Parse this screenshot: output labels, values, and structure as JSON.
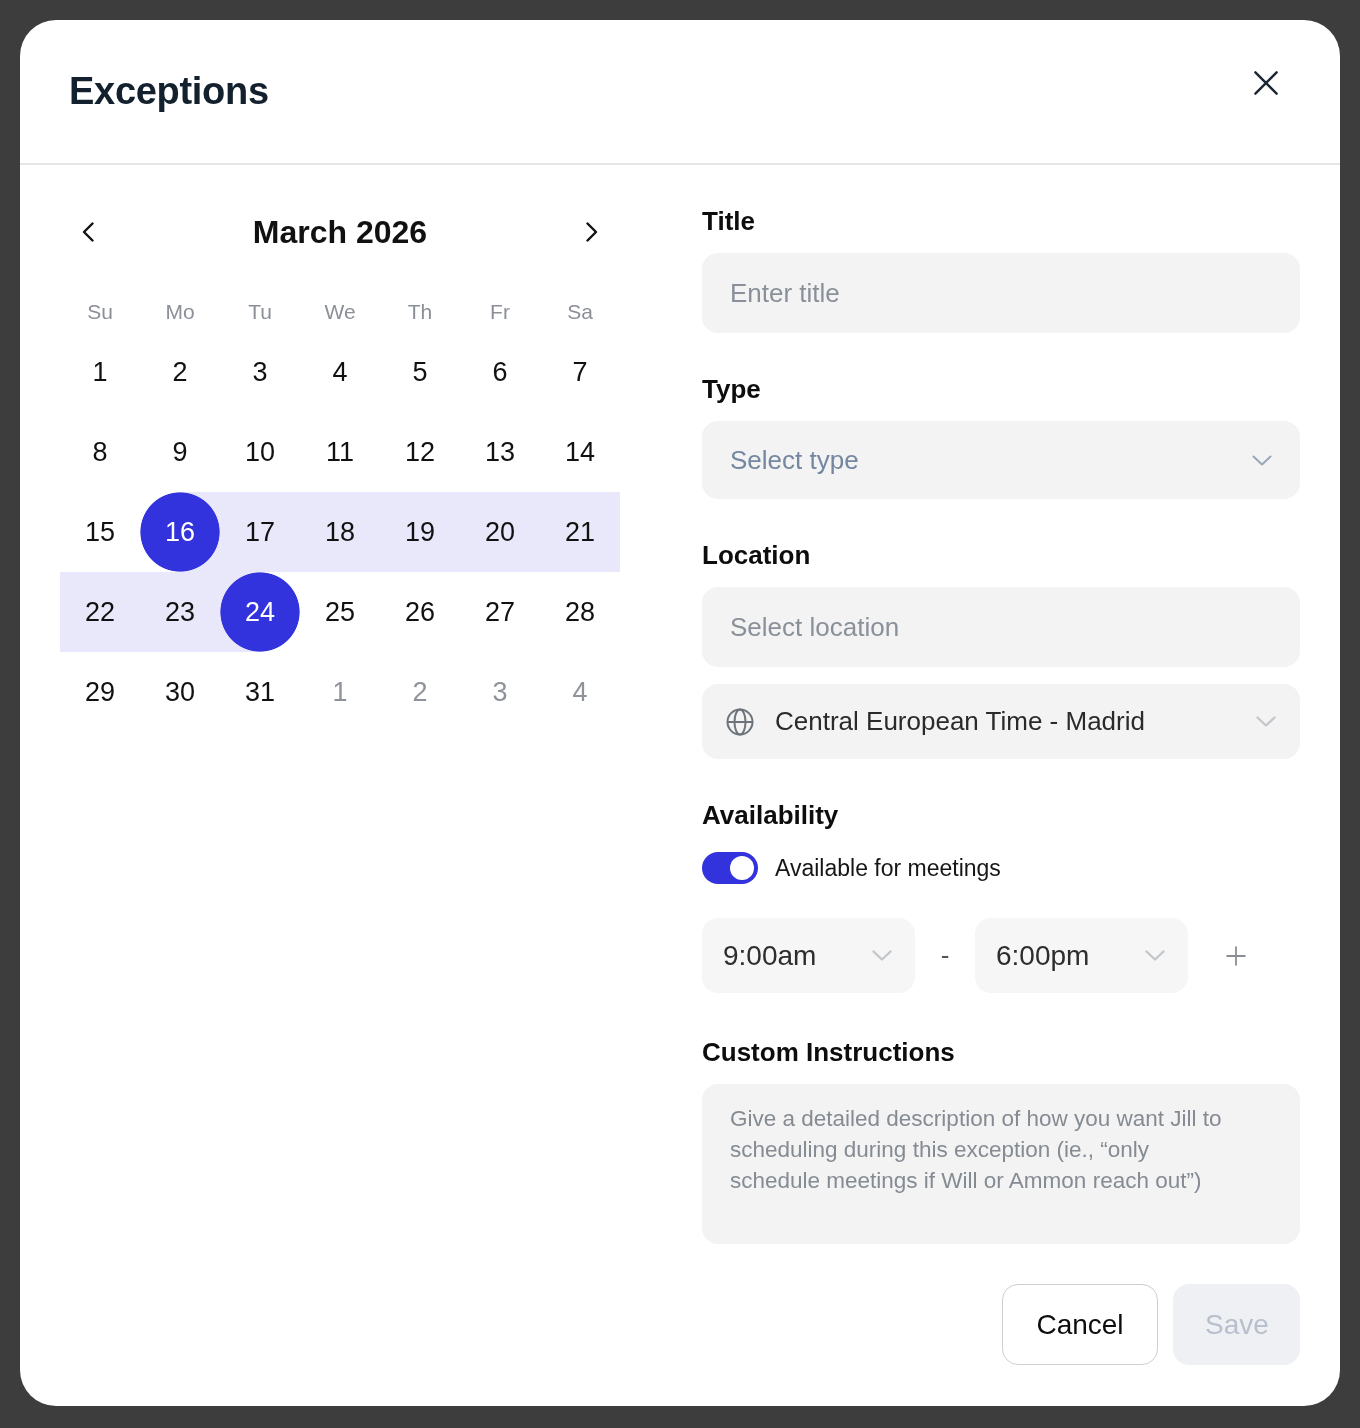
{
  "dialog": {
    "title": "Exceptions"
  },
  "calendar": {
    "month_title": "March 2026",
    "weekdays": [
      "Su",
      "Mo",
      "Tu",
      "We",
      "Th",
      "Fr",
      "Sa"
    ],
    "days": [
      {
        "label": "1",
        "selected": false,
        "in_range": false,
        "outside": false
      },
      {
        "label": "2",
        "selected": false,
        "in_range": false,
        "outside": false
      },
      {
        "label": "3",
        "selected": false,
        "in_range": false,
        "outside": false
      },
      {
        "label": "4",
        "selected": false,
        "in_range": false,
        "outside": false
      },
      {
        "label": "5",
        "selected": false,
        "in_range": false,
        "outside": false
      },
      {
        "label": "6",
        "selected": false,
        "in_range": false,
        "outside": false
      },
      {
        "label": "7",
        "selected": false,
        "in_range": false,
        "outside": false
      },
      {
        "label": "8",
        "selected": false,
        "in_range": false,
        "outside": false
      },
      {
        "label": "9",
        "selected": false,
        "in_range": false,
        "outside": false
      },
      {
        "label": "10",
        "selected": false,
        "in_range": false,
        "outside": false
      },
      {
        "label": "11",
        "selected": false,
        "in_range": false,
        "outside": false
      },
      {
        "label": "12",
        "selected": false,
        "in_range": false,
        "outside": false
      },
      {
        "label": "13",
        "selected": false,
        "in_range": false,
        "outside": false
      },
      {
        "label": "14",
        "selected": false,
        "in_range": false,
        "outside": false
      },
      {
        "label": "15",
        "selected": false,
        "in_range": false,
        "outside": false
      },
      {
        "label": "16",
        "selected": true,
        "in_range": false,
        "outside": false
      },
      {
        "label": "17",
        "selected": false,
        "in_range": true,
        "outside": false
      },
      {
        "label": "18",
        "selected": false,
        "in_range": true,
        "outside": false
      },
      {
        "label": "19",
        "selected": false,
        "in_range": true,
        "outside": false
      },
      {
        "label": "20",
        "selected": false,
        "in_range": true,
        "outside": false
      },
      {
        "label": "21",
        "selected": false,
        "in_range": true,
        "outside": false
      },
      {
        "label": "22",
        "selected": false,
        "in_range": true,
        "outside": false
      },
      {
        "label": "23",
        "selected": false,
        "in_range": true,
        "outside": false
      },
      {
        "label": "24",
        "selected": true,
        "in_range": false,
        "outside": false
      },
      {
        "label": "25",
        "selected": false,
        "in_range": false,
        "outside": false
      },
      {
        "label": "26",
        "selected": false,
        "in_range": false,
        "outside": false
      },
      {
        "label": "27",
        "selected": false,
        "in_range": false,
        "outside": false
      },
      {
        "label": "28",
        "selected": false,
        "in_range": false,
        "outside": false
      },
      {
        "label": "29",
        "selected": false,
        "in_range": false,
        "outside": false
      },
      {
        "label": "30",
        "selected": false,
        "in_range": false,
        "outside": false
      },
      {
        "label": "31",
        "selected": false,
        "in_range": false,
        "outside": false
      },
      {
        "label": "1",
        "selected": false,
        "in_range": false,
        "outside": true
      },
      {
        "label": "2",
        "selected": false,
        "in_range": false,
        "outside": true
      },
      {
        "label": "3",
        "selected": false,
        "in_range": false,
        "outside": true
      },
      {
        "label": "4",
        "selected": false,
        "in_range": false,
        "outside": true
      }
    ]
  },
  "form": {
    "title_field": {
      "label": "Title",
      "placeholder": "Enter title"
    },
    "type_field": {
      "label": "Type",
      "placeholder": "Select type"
    },
    "location": {
      "label": "Location",
      "placeholder": "Select location",
      "timezone": "Central European Time - Madrid"
    },
    "availability": {
      "label": "Availability",
      "toggle": {
        "label": "Available for meetings",
        "on": true
      },
      "start_time": "9:00am",
      "separator": "-",
      "end_time": "6:00pm"
    },
    "instructions": {
      "label": "Custom Instructions",
      "placeholder": "Give a detailed description of how you want Jill to scheduling during this exception (ie., “only schedule meetings if Will or Ammon reach out”)"
    }
  },
  "buttons": [
    {
      "label": "Cancel",
      "kind": "secondary",
      "disabled": false
    },
    {
      "label": "Save",
      "kind": "primary",
      "disabled": true
    }
  ]
}
